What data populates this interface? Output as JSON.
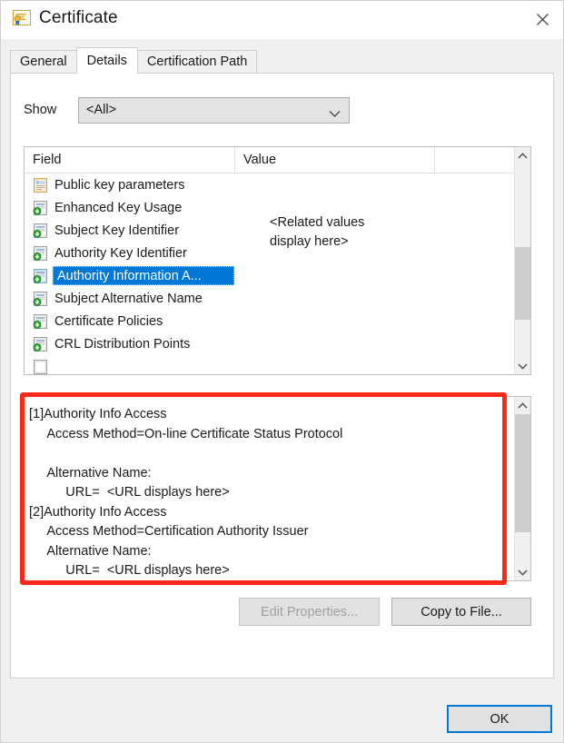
{
  "window": {
    "title": "Certificate",
    "icon": "certificate-icon",
    "close_label": "✕"
  },
  "tabs": [
    {
      "label": "General",
      "active": false
    },
    {
      "label": "Details",
      "active": true
    },
    {
      "label": "Certification Path",
      "active": false
    }
  ],
  "show": {
    "label": "Show",
    "value": "<All>",
    "options": [
      "<All>"
    ]
  },
  "field_list": {
    "columns": [
      "Field",
      "Value",
      ""
    ],
    "rows": [
      {
        "label": "Public key parameters",
        "icon": "document-icon",
        "selected": false
      },
      {
        "label": "Enhanced Key Usage",
        "icon": "extension-download-icon",
        "selected": false
      },
      {
        "label": "Subject Key Identifier",
        "icon": "extension-download-icon",
        "selected": false
      },
      {
        "label": "Authority Key Identifier",
        "icon": "extension-download-icon",
        "selected": false
      },
      {
        "label": "Authority Information A...",
        "icon": "extension-download-icon",
        "selected": true
      },
      {
        "label": "Subject Alternative Name",
        "icon": "extension-download-icon",
        "selected": false
      },
      {
        "label": "Certificate Policies",
        "icon": "extension-download-icon",
        "selected": false
      },
      {
        "label": "CRL Distribution Points",
        "icon": "extension-download-icon",
        "selected": false
      }
    ],
    "value_cell": "<Related values\ndisplay here>"
  },
  "detail": {
    "text": "[1]Authority Info Access\n     Access Method=On-line Certificate Status Protocol\n\n     Alternative Name:\n          URL=  <URL displays here>\n[2]Authority Info Access\n     Access Method=Certification Authority Issuer\n     Alternative Name:\n          URL=  <URL displays here>"
  },
  "buttons": {
    "edit_properties": "Edit Properties...",
    "copy_to_file": "Copy to File...",
    "ok": "OK"
  },
  "colors": {
    "selection_blue": "#0078d7",
    "highlight_red": "#fb2a18",
    "dialog_bg": "#f0f0f0",
    "panel_bg": "#ffffff"
  }
}
